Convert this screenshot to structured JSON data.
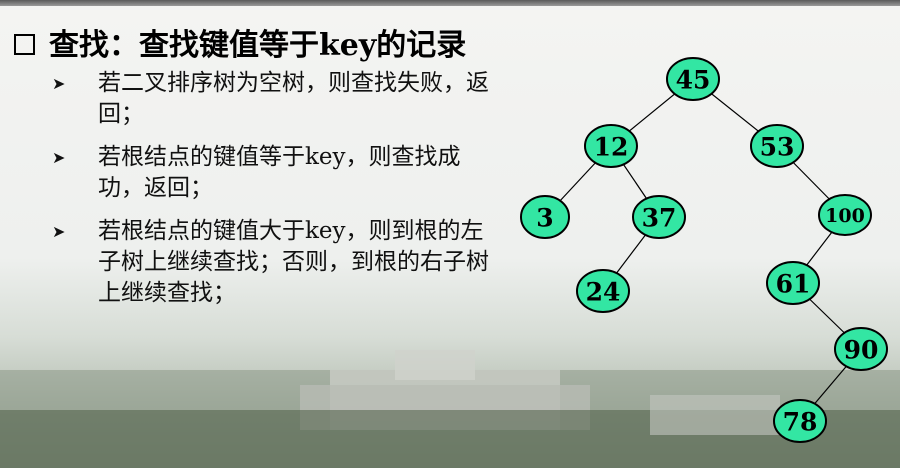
{
  "title": "查找：查找键值等于key的记录",
  "bullets": [
    "若二叉排序树为空树，则查找失败，返回；",
    "若根结点的键值等于key，则查找成功，返回；",
    "若根结点的键值大于key，则到根的左子树上继续查找；否则，到根的右子树上继续查找；"
  ],
  "icons": {
    "title_bullet": "checkbox-icon",
    "item_bullet": "arrowhead-bullet-icon"
  },
  "colors": {
    "node_fill": "#33e6a3",
    "node_stroke": "#000000"
  },
  "tree": {
    "nodes": [
      {
        "id": "n45",
        "label": "45"
      },
      {
        "id": "n12",
        "label": "12"
      },
      {
        "id": "n53",
        "label": "53"
      },
      {
        "id": "n3",
        "label": "3"
      },
      {
        "id": "n37",
        "label": "37"
      },
      {
        "id": "n100",
        "label": "100"
      },
      {
        "id": "n24",
        "label": "24"
      },
      {
        "id": "n61",
        "label": "61"
      },
      {
        "id": "n90",
        "label": "90"
      },
      {
        "id": "n78",
        "label": "78"
      }
    ],
    "edges": [
      [
        "n45",
        "n12"
      ],
      [
        "n45",
        "n53"
      ],
      [
        "n12",
        "n3"
      ],
      [
        "n12",
        "n37"
      ],
      [
        "n53",
        "n100"
      ],
      [
        "n37",
        "n24"
      ],
      [
        "n100",
        "n61"
      ],
      [
        "n61",
        "n90"
      ],
      [
        "n90",
        "n78"
      ]
    ]
  }
}
